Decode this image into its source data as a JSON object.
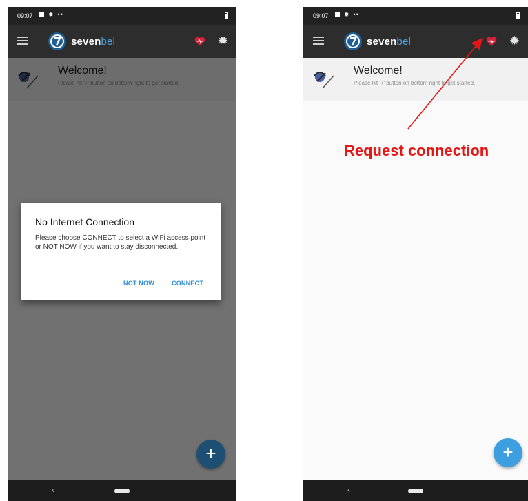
{
  "status_bar": {
    "time": "09:07"
  },
  "app_bar": {
    "logo_part1": "seven",
    "logo_part2": "bel"
  },
  "welcome": {
    "title": "Welcome!",
    "subtitle": "Please hit '+' button on bottom right to get started."
  },
  "dialog": {
    "title": "No Internet Connection",
    "body": "Please choose CONNECT to select a WiFi access point or NOT NOW if you want to stay disconnected.",
    "not_now_label": "NOT NOW",
    "connect_label": "CONNECT"
  },
  "fab": {
    "label": "+"
  },
  "annotation": {
    "text": "Request connection"
  },
  "colors": {
    "accent": "#3d9ee0",
    "heart": "#d3233a",
    "annotation": "#e51616",
    "appbar": "#2d2d2d"
  },
  "icons": [
    "menu-icon",
    "heart-icon",
    "settings-icon",
    "plus-icon",
    "back-icon",
    "home-pill-icon"
  ]
}
